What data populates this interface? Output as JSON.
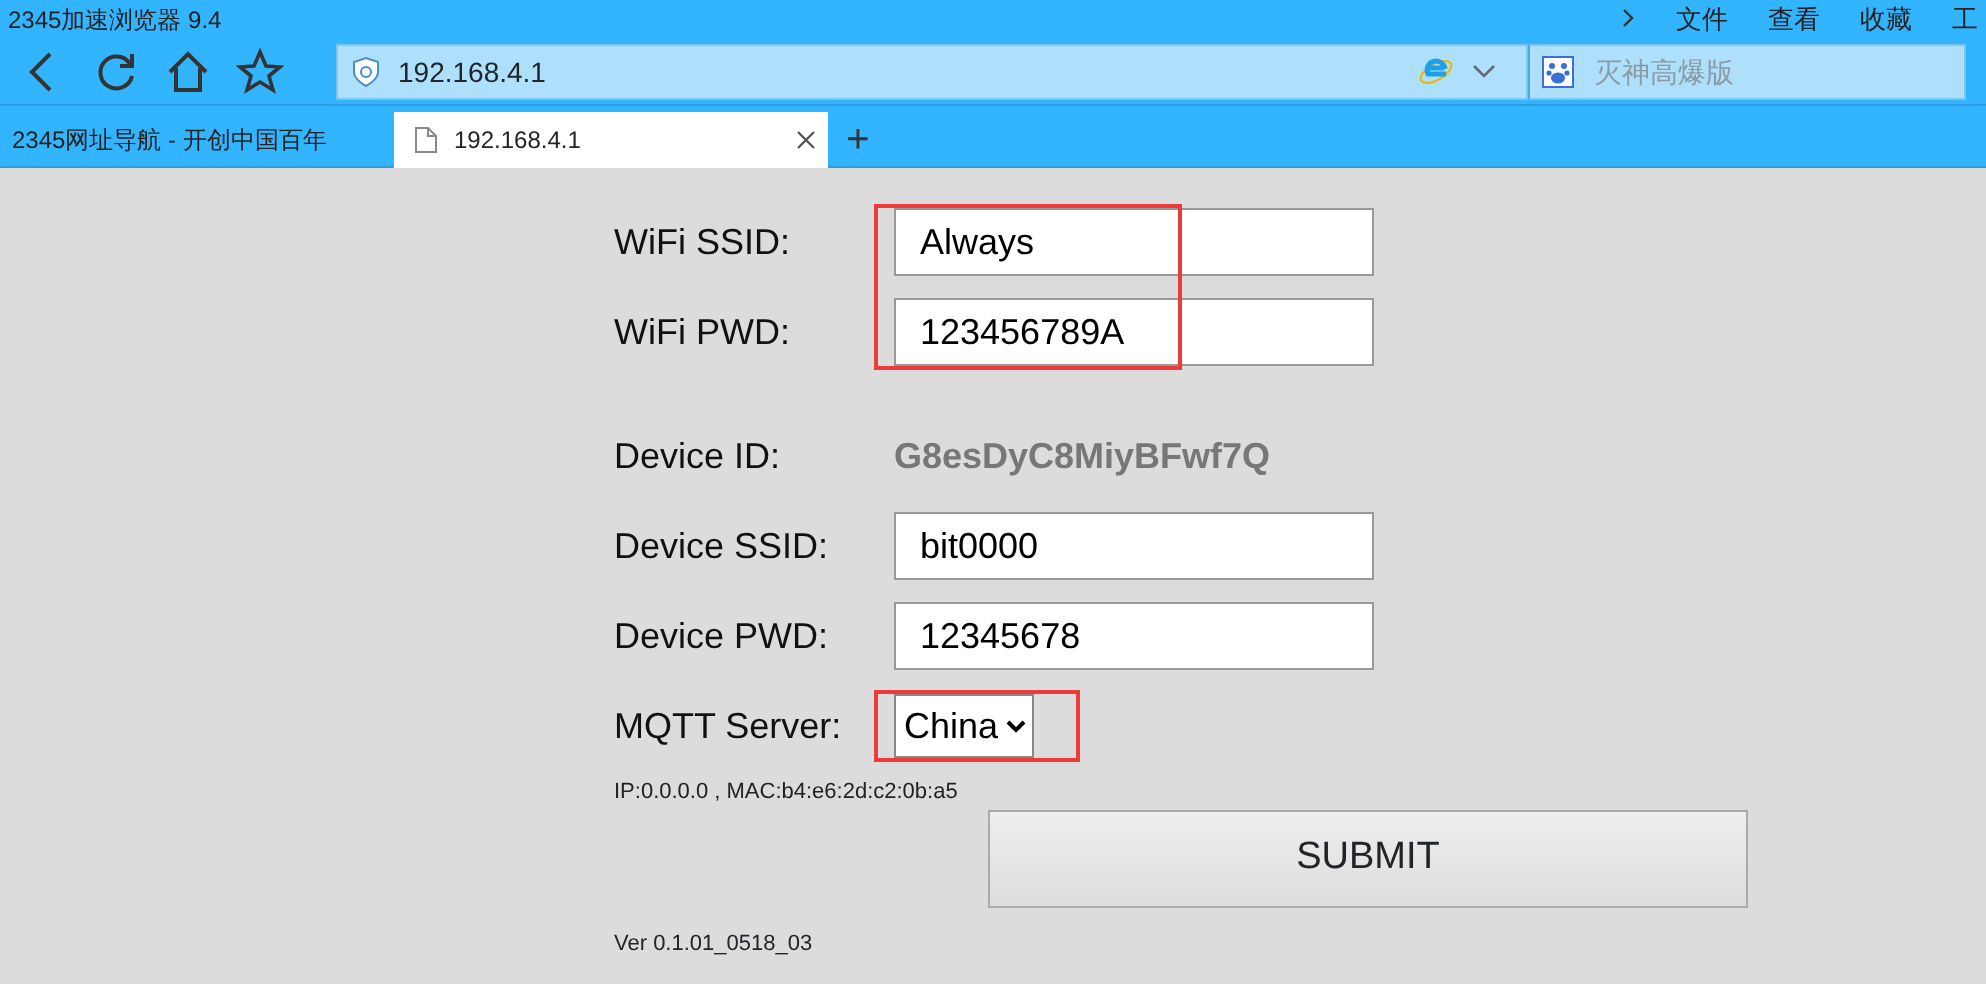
{
  "window": {
    "title": "2345加速浏览器 9.4"
  },
  "menu": [
    "文件",
    "查看",
    "收藏",
    "工"
  ],
  "toolbar": {
    "address": "192.168.4.1",
    "search_placeholder": "灭神高爆版"
  },
  "tabs": [
    {
      "label": "2345网址导航 - 开创中国百年",
      "selected": false
    },
    {
      "label": "192.168.4.1",
      "selected": true
    }
  ],
  "new_tab": "+",
  "form": {
    "rows": [
      {
        "kind": "input",
        "label": "WiFi SSID:",
        "value": "Always",
        "highlighted": true
      },
      {
        "kind": "input",
        "label": "WiFi PWD:",
        "value": "123456789A",
        "highlighted": true
      },
      {
        "kind": "text",
        "label": "Device ID:",
        "value": "G8esDyC8MiyBFwf7Q",
        "highlighted": false
      },
      {
        "kind": "input",
        "label": "Device SSID:",
        "value": "bit0000",
        "highlighted": false
      },
      {
        "kind": "input",
        "label": "Device PWD:",
        "value": "12345678",
        "highlighted": false
      },
      {
        "kind": "select",
        "label": "MQTT Server:",
        "value": "China",
        "highlighted": true
      }
    ],
    "info": "IP:0.0.0.0 , MAC:b4:e6:2d:c2:0b:a5",
    "submit": "SUBMIT",
    "version": "Ver 0.1.01_0518_03"
  }
}
